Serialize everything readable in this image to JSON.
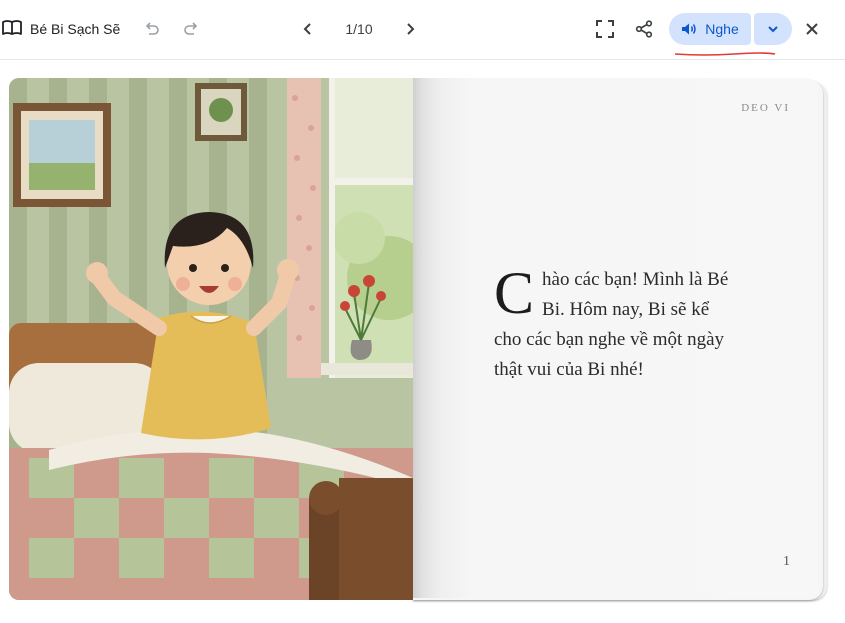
{
  "toolbar": {
    "book_title": "Bé Bi Sạch Sẽ",
    "page_indicator": "1/10",
    "listen_label": "Nghe",
    "icons": [
      "book-icon",
      "undo-icon",
      "redo-icon",
      "chevron-left-icon",
      "chevron-right-icon",
      "fullscreen-icon",
      "share-icon",
      "speaker-icon",
      "chevron-down-icon",
      "close-icon"
    ]
  },
  "page": {
    "header": "DEO VI",
    "drop_cap": "C",
    "text": "hào các bạn! Mình là Bé Bi. Hôm nay, Bi sẽ kể cho các bạn nghe về một ngày thật vui của Bi nhé!",
    "page_number": "1"
  },
  "colors": {
    "accent": "#0b57d0",
    "listen_bg": "#d3e3fd",
    "annotation_red": "#e53935"
  }
}
